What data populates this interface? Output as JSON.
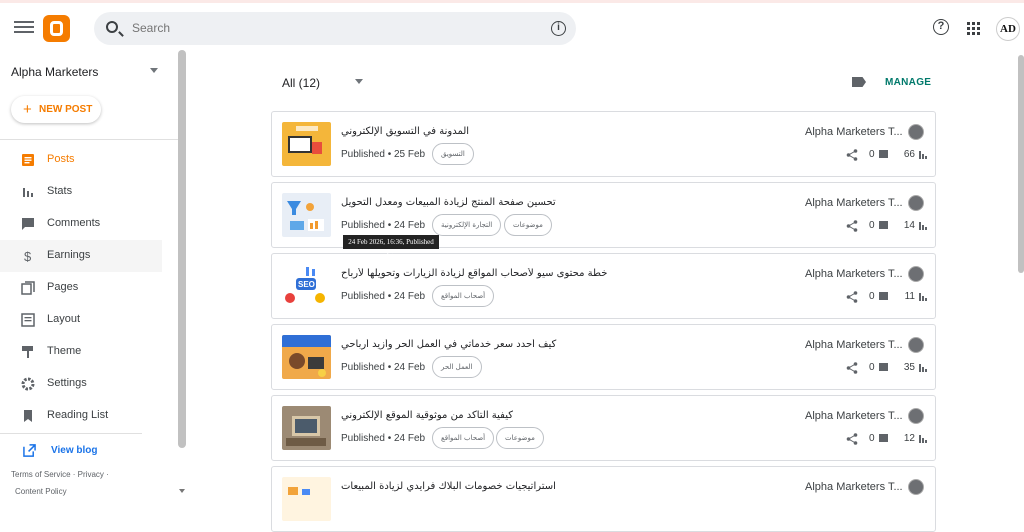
{
  "header": {
    "search_placeholder": "Search",
    "avatar_initials": "AD"
  },
  "sidebar": {
    "blog_name": "Alpha Marketers",
    "new_post_label": "NEW POST",
    "items": [
      {
        "label": "Posts",
        "icon": "posts-icon",
        "active": true
      },
      {
        "label": "Stats",
        "icon": "stats-icon"
      },
      {
        "label": "Comments",
        "icon": "comments-icon"
      },
      {
        "label": "Earnings",
        "icon": "dollar-icon"
      },
      {
        "label": "Pages",
        "icon": "pages-icon"
      },
      {
        "label": "Layout",
        "icon": "layout-icon"
      },
      {
        "label": "Theme",
        "icon": "theme-icon"
      },
      {
        "label": "Settings",
        "icon": "gear-icon"
      },
      {
        "label": "Reading List",
        "icon": "bookmark-icon"
      }
    ],
    "view_blog_label": "View blog",
    "footer_line1": "Terms of Service  ·  Privacy  ·",
    "footer_line2": "Content Policy"
  },
  "main": {
    "filter_label": "All (12)",
    "manage_label": "MANAGE",
    "tooltip": "24 Feb 2026, 16:36, Published date",
    "posts": [
      {
        "title": "المدونة في التسويق الإلكتروني",
        "status": "Published",
        "date": "25 Feb",
        "labels": [
          "التسويق"
        ],
        "author": "Alpha Marketers T...",
        "comments": "0",
        "views": "66",
        "thumb_color": "#f4b63a"
      },
      {
        "title": "تحسين صفحة المنتج لزيادة المبيعات ومعدل التحويل",
        "status": "Published",
        "date": "24 Feb",
        "labels": [
          "التجارة الإلكترونية",
          "موضوعات"
        ],
        "author": "Alpha Marketers T...",
        "comments": "0",
        "views": "14",
        "thumb_color": "#e8eef6"
      },
      {
        "title": "خطة محتوى سيو لأصحاب المواقع لزيادة الزيارات وتحويلها لأرباح",
        "status": "Published",
        "date": "24 Feb",
        "labels": [
          "أصحاب المواقع"
        ],
        "author": "Alpha Marketers T...",
        "comments": "0",
        "views": "11",
        "thumb_color": "#ffffff"
      },
      {
        "title": "كيف أحدد سعر خدماتي في العمل الحر وأزيد أرباحي",
        "status": "Published",
        "date": "24 Feb",
        "labels": [
          "العمل الحر"
        ],
        "author": "Alpha Marketers T...",
        "comments": "0",
        "views": "35",
        "thumb_color": "#f0a94a"
      },
      {
        "title": "كيفية التأكد من موثوقية الموقع الإلكتروني",
        "status": "Published",
        "date": "24 Feb",
        "labels": [
          "أصحاب المواقع",
          "موضوعات"
        ],
        "author": "Alpha Marketers T...",
        "comments": "0",
        "views": "12",
        "thumb_color": "#9c8a74"
      },
      {
        "title": "استراتيجيات خصومات البلاك فرايدي لزيادة المبيعات",
        "status": "",
        "date": "",
        "labels": [],
        "author": "Alpha Marketers T...",
        "comments": "",
        "views": "",
        "thumb_color": "#fff4e0"
      }
    ]
  }
}
